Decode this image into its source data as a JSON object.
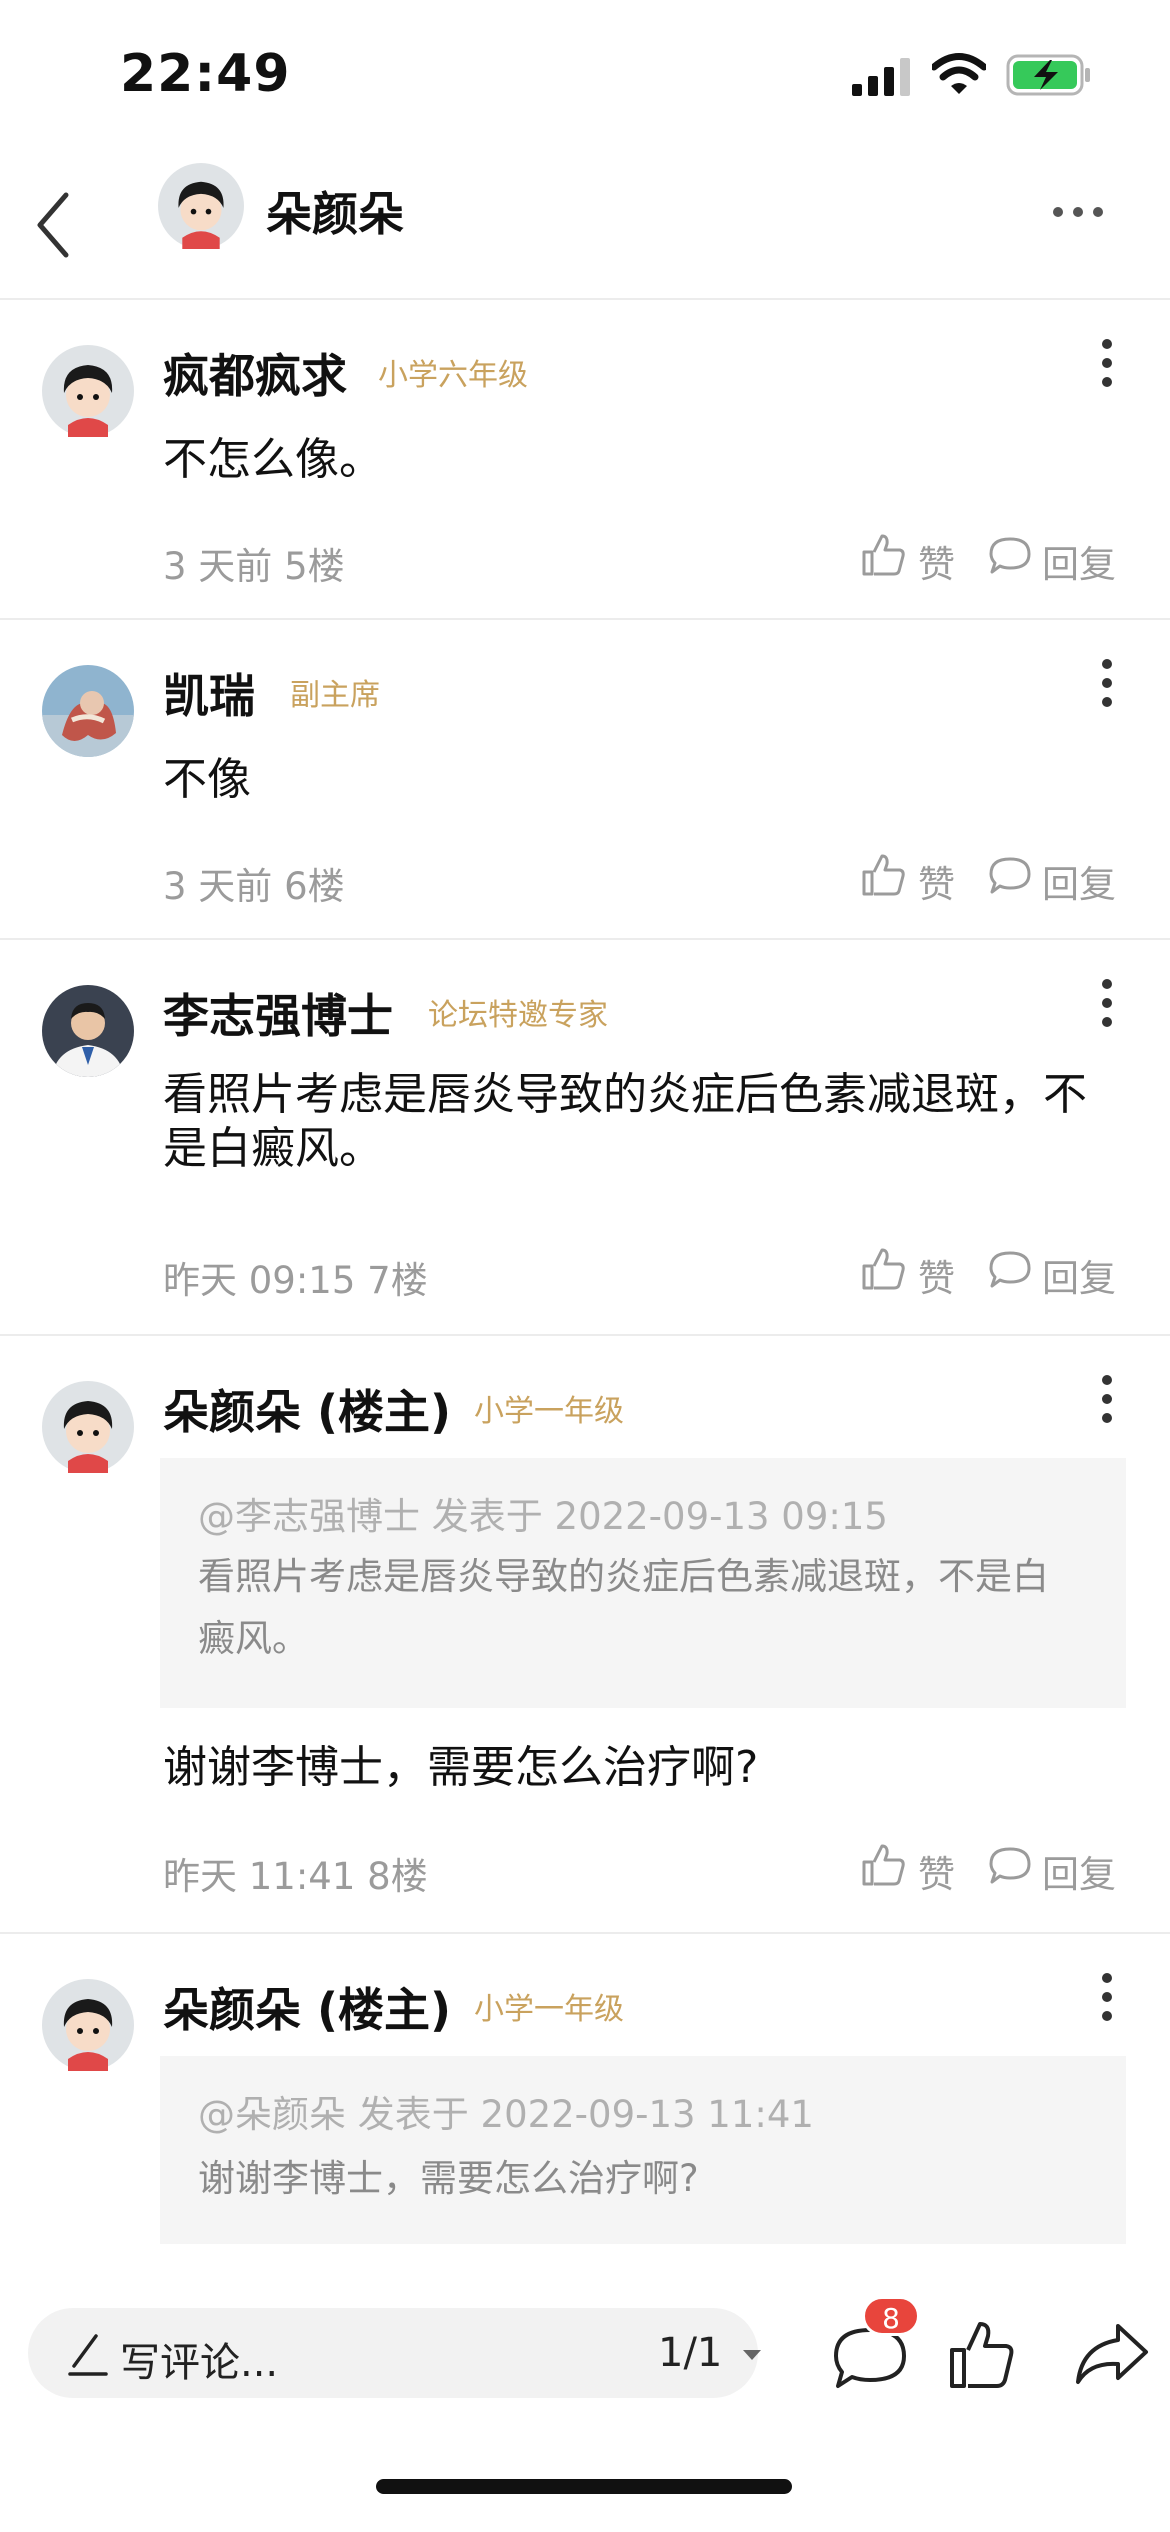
{
  "status": {
    "time": "22:49"
  },
  "header": {
    "title": "朵颜朵"
  },
  "posts": [
    {
      "name": "疯都疯求",
      "badge": "小学六年级",
      "content": "不怎么像。",
      "meta": "3 天前  5楼",
      "like": "赞",
      "reply": "回复"
    },
    {
      "name": "凯瑞",
      "badge": "副主席",
      "content": "不像",
      "meta": "3 天前  6楼",
      "like": "赞",
      "reply": "回复"
    },
    {
      "name": "李志强博士",
      "badge": "论坛特邀专家",
      "content": "看照片考虑是唇炎导致的炎症后色素减退斑，不是白癜风。",
      "meta": "昨天 09:15  7楼",
      "like": "赞",
      "reply": "回复"
    },
    {
      "name": "朵颜朵 (楼主)",
      "badge": "小学一年级",
      "quote_head": "@李志强博士 发表于 2022-09-13 09:15",
      "quote_text": "看照片考虑是唇炎导致的炎症后色素减退斑，不是白癜风。",
      "content": "谢谢李博士，需要怎么治疗啊?",
      "meta": "昨天 11:41  8楼",
      "like": "赞",
      "reply": "回复"
    },
    {
      "name": "朵颜朵 (楼主)",
      "badge": "小学一年级",
      "quote_head": "@朵颜朵 发表于 2022-09-13 11:41",
      "quote_text": "谢谢李博士，需要怎么治疗啊?"
    }
  ],
  "bottom": {
    "placeholder": "写评论...",
    "page": "1/1",
    "comment_count": "8"
  },
  "colors": {
    "badge": "#c9a25e",
    "meta": "#9b9b9b",
    "quote_bg": "#f5f5f5",
    "count_badge": "#e8453c"
  },
  "icons": [
    "back-icon",
    "more-icon",
    "kebab-icon",
    "like-icon",
    "reply-icon",
    "pen-icon",
    "comment-icon",
    "thumb-up-icon",
    "share-icon"
  ]
}
